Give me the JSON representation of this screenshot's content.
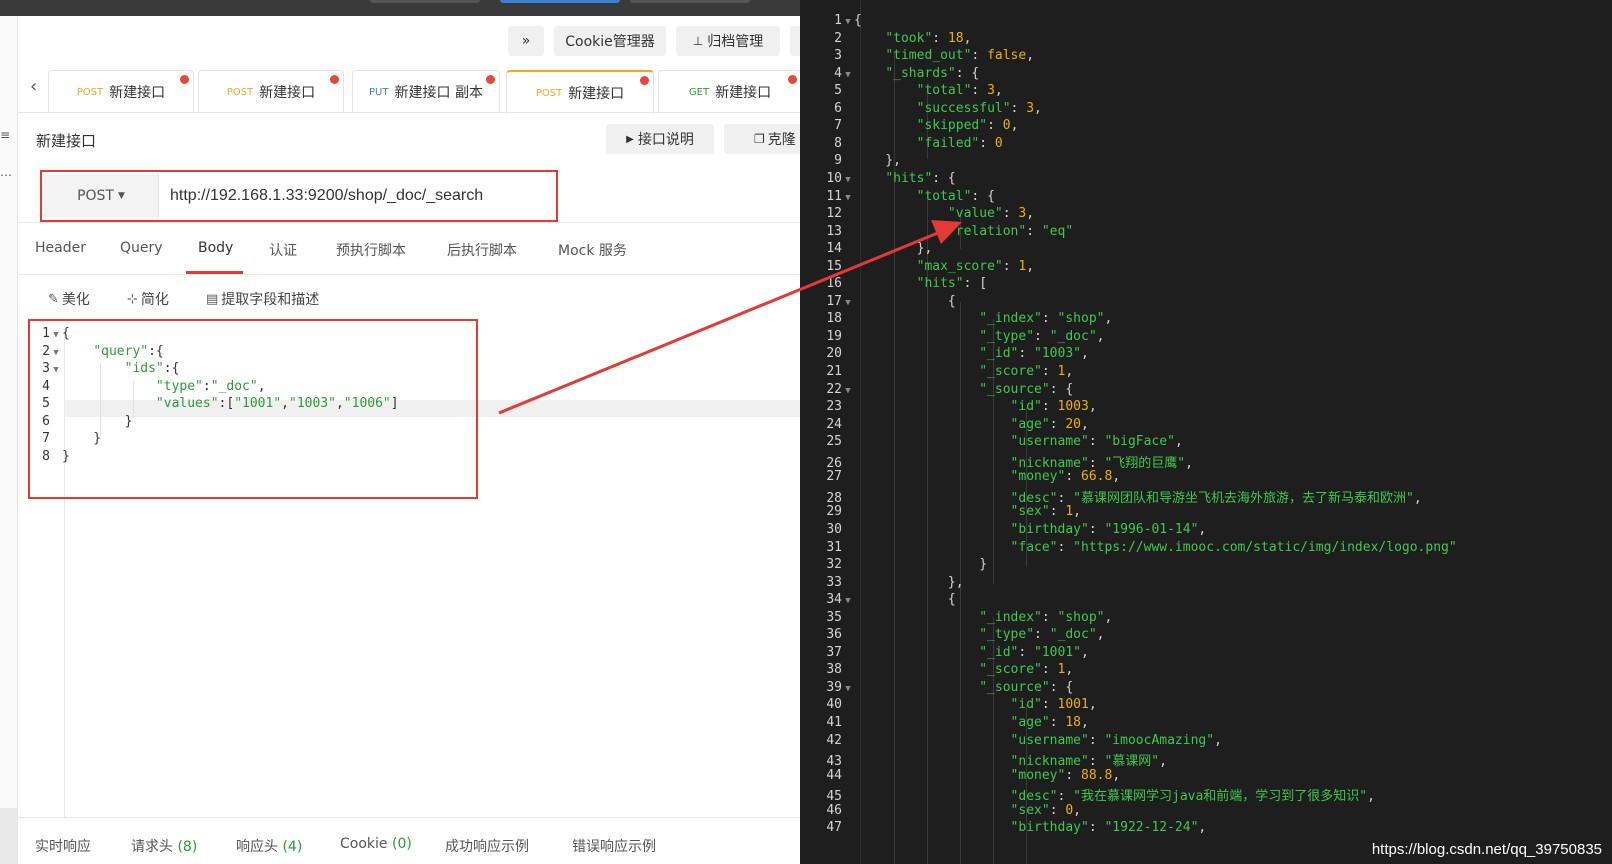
{
  "toolbar": {
    "more_icon": "»",
    "cookie_label": "Cookie管理器",
    "archive_label": "归档管理"
  },
  "tabs": [
    {
      "method": "POST",
      "name": "新建接口",
      "method_color": "#f5a623",
      "unsaved": true
    },
    {
      "method": "POST",
      "name": "新建接口",
      "method_color": "#f5a623",
      "unsaved": true
    },
    {
      "method": "PUT",
      "name": "新建接口 副本",
      "method_color": "#3b82d6",
      "unsaved": true
    },
    {
      "method": "POST",
      "name": "新建接口",
      "method_color": "#f5a623",
      "unsaved": true,
      "active": true
    },
    {
      "method": "GET",
      "name": "新建接口",
      "method_color": "#2a9c33",
      "unsaved": true
    }
  ],
  "request": {
    "title": "新建接口",
    "doc_button": "接口说明",
    "clone_button": "克隆",
    "method": "POST",
    "url": "http://192.168.1.33:9200/shop/_doc/_search"
  },
  "request_tabs": [
    "Header",
    "Query",
    "Body",
    "认证",
    "预执行脚本",
    "后执行脚本",
    "Mock 服务"
  ],
  "active_request_tab": "Body",
  "editor_tools": {
    "beautify": "美化",
    "simplify": "简化",
    "extract": "提取字段和描述"
  },
  "body_lines": [
    "{",
    "  \"query\":{",
    "    \"ids\":{",
    "      \"type\":\"_doc\",",
    "      \"values\":[\"1001\",\"1003\",\"1006\"]",
    "    }",
    "  }",
    "}"
  ],
  "bottom_tabs": [
    {
      "label": "实时响应",
      "count": ""
    },
    {
      "label": "请求头",
      "count": "(8)"
    },
    {
      "label": "响应头",
      "count": "(4)"
    },
    {
      "label": "Cookie",
      "count": "(0)"
    },
    {
      "label": "成功响应示例",
      "count": ""
    },
    {
      "label": "错误响应示例",
      "count": ""
    }
  ],
  "response_lines": [
    "{",
    "    \"took\": 18,",
    "    \"timed_out\": false,",
    "    \"_shards\": {",
    "        \"total\": 3,",
    "        \"successful\": 3,",
    "        \"skipped\": 0,",
    "        \"failed\": 0",
    "    },",
    "    \"hits\": {",
    "        \"total\": {",
    "            \"value\": 3,",
    "            \"relation\": \"eq\"",
    "        },",
    "        \"max_score\": 1,",
    "        \"hits\": [",
    "            {",
    "                \"_index\": \"shop\",",
    "                \"_type\": \"_doc\",",
    "                \"_id\": \"1003\",",
    "                \"_score\": 1,",
    "                \"_source\": {",
    "                    \"id\": 1003,",
    "                    \"age\": 20,",
    "                    \"username\": \"bigFace\",",
    "                    \"nickname\": \"飞翔的巨鹰\",",
    "                    \"money\": 66.8,",
    "                    \"desc\": \"慕课网团队和导游坐飞机去海外旅游，去了新马泰和欧洲\",",
    "                    \"sex\": 1,",
    "                    \"birthday\": \"1996-01-14\",",
    "                    \"face\": \"https://www.imooc.com/static/img/index/logo.png\"",
    "                }",
    "            },",
    "            {",
    "                \"_index\": \"shop\",",
    "                \"_type\": \"_doc\",",
    "                \"_id\": \"1001\",",
    "                \"_score\": 1,",
    "                \"_source\": {",
    "                    \"id\": 1001,",
    "                    \"age\": 18,",
    "                    \"username\": \"imoocAmazing\",",
    "                    \"nickname\": \"慕课网\",",
    "                    \"money\": 88.8,",
    "                    \"desc\": \"我在慕课网学习java和前端，学习到了很多知识\",",
    "                    \"sex\": 0,",
    "                    \"birthday\": \"1922-12-24\","
  ],
  "response_folds": [
    1,
    4,
    10,
    11,
    17,
    22,
    34,
    39
  ],
  "watermark": "https://blog.csdn.net/qq_39750835",
  "colors": {
    "annotation_red": "#e53935",
    "accent_orange": "#f5a623",
    "json_key_green": "#3fc94d",
    "json_number_yellow": "#f0b000",
    "dark_bg": "#1e1e1e"
  }
}
